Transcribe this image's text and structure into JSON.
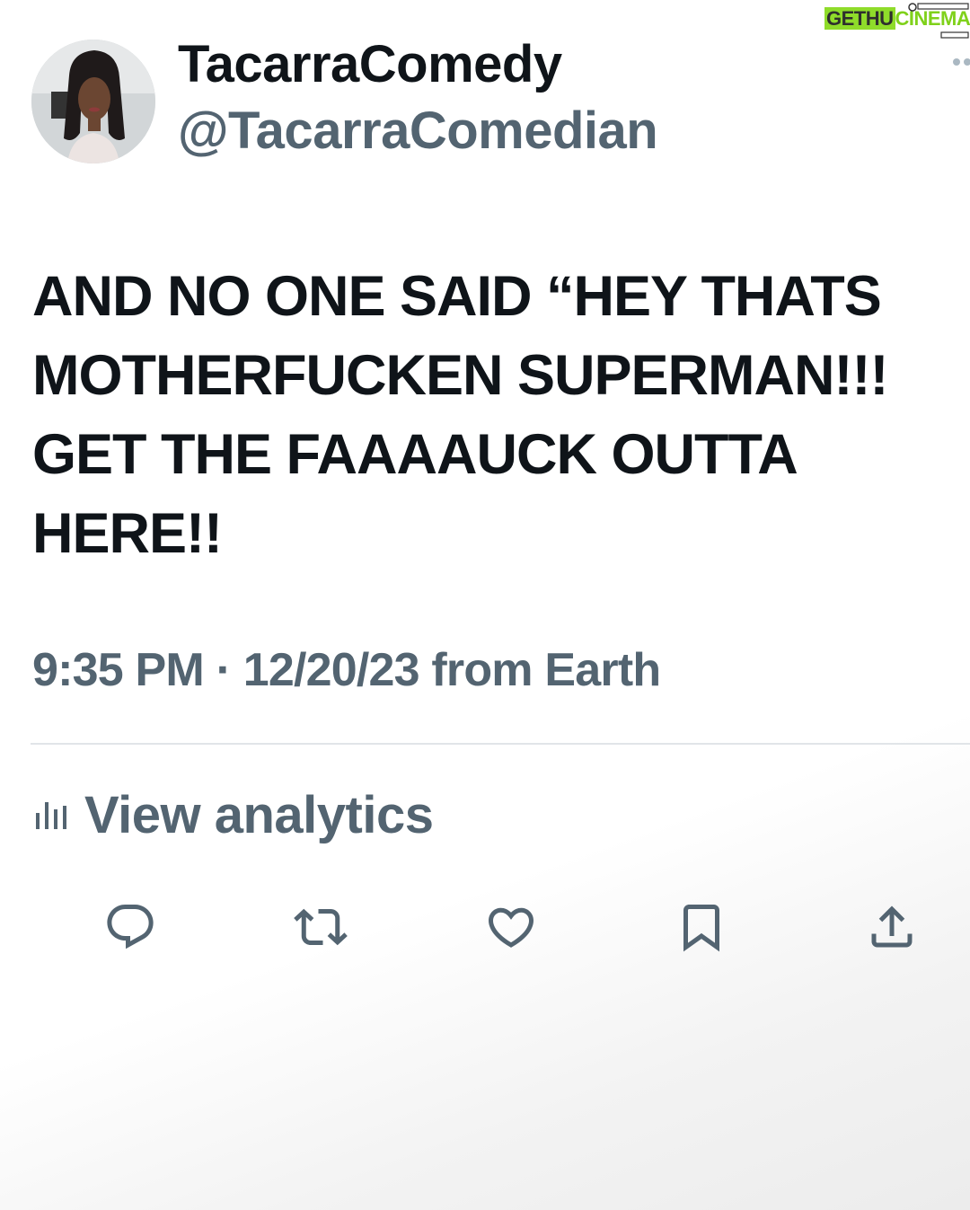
{
  "watermark": {
    "part1": "GETHU",
    "part2": "CINEMA"
  },
  "user": {
    "display_name": "TacarraComedy",
    "handle": "@TacarraComedian"
  },
  "tweet": {
    "lines": [
      "AND NO ONE SAID “HEY THATS",
      "MOTHERFUCKEN SUPERMAN!!!",
      "GET THE FAAAAUCK OUTTA",
      "HERE!!"
    ],
    "meta": "9:35 PM · 12/20/23 from Earth"
  },
  "analytics": {
    "label": "View analytics",
    "icon": "bar-chart-icon"
  },
  "actions": [
    {
      "icon": "reply-icon"
    },
    {
      "icon": "retweet-icon"
    },
    {
      "icon": "like-icon"
    },
    {
      "icon": "bookmark-icon"
    },
    {
      "icon": "share-icon"
    }
  ],
  "colors": {
    "primary_text": "#0f1419",
    "secondary_text": "#536471",
    "divider": "#e1e5e8"
  }
}
